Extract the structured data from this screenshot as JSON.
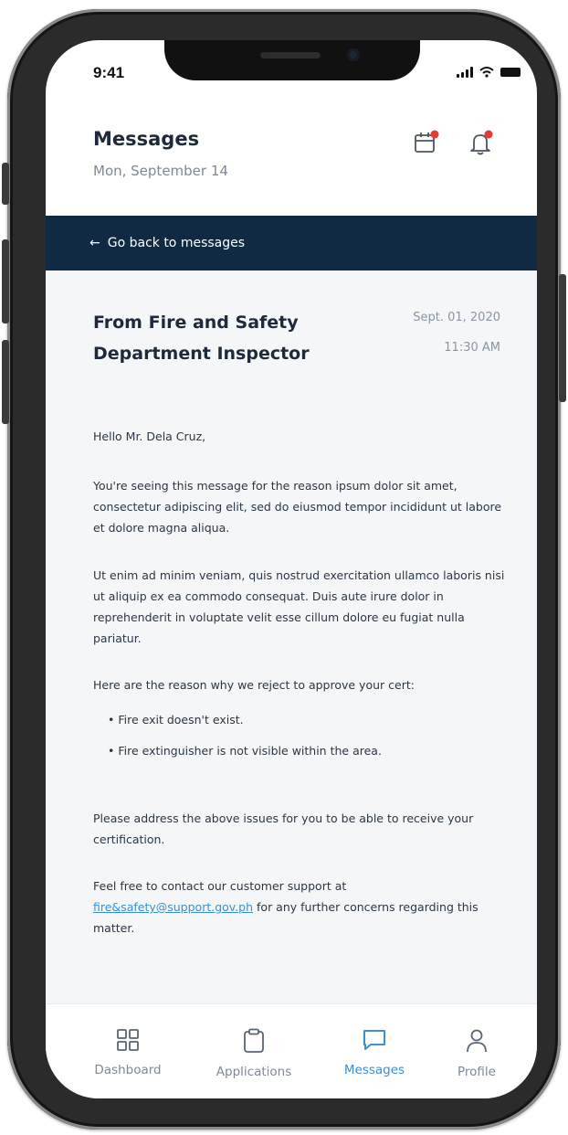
{
  "status_bar": {
    "time": "9:41"
  },
  "header": {
    "title": "Messages",
    "date": "Mon, September 14"
  },
  "back_link": {
    "arrow": "←",
    "label": "Go back to messages"
  },
  "message": {
    "from": "From Fire and Safety Department Inspector",
    "date": "Sept. 01, 2020",
    "time": "11:30 AM",
    "greeting": "Hello Mr. Dela Cruz,",
    "paragraph_1": "You're seeing this message for the reason ipsum dolor sit amet, consectetur adipiscing elit, sed do eiusmod tempor incididunt ut labore et dolore magna aliqua.",
    "paragraph_2": "Ut enim ad minim veniam, quis nostrud exercitation ullamco laboris nisi ut aliquip ex ea commodo consequat. Duis aute irure dolor in reprehenderit in voluptate velit esse cillum dolore eu fugiat nulla pariatur.",
    "reasons_intro": "Here are the reason why we reject to approve your cert:",
    "reasons": [
      "• Fire exit doesn't exist.",
      "• Fire extinguisher is not visible within the area."
    ],
    "paragraph_3": "Please address the above issues for you to be able to receive your certification.",
    "contact_prefix": "Feel free to contact our customer support at ",
    "contact_email": "fire&safety@support.gov.ph",
    "contact_suffix": " for any further concerns regarding this matter."
  },
  "tabbar": {
    "tabs": [
      {
        "label": "Dashboard",
        "icon": "grid-icon",
        "active": false
      },
      {
        "label": "Applications",
        "icon": "clipboard-icon",
        "active": false
      },
      {
        "label": "Messages",
        "icon": "chat-icon",
        "active": true
      },
      {
        "label": "Profile",
        "icon": "user-icon",
        "active": false
      }
    ]
  },
  "colors": {
    "accent": "#3b8fd6",
    "back_bar": "#0f2a42",
    "notification_dot": "#e53935",
    "content_bg": "#f4f6f8"
  }
}
